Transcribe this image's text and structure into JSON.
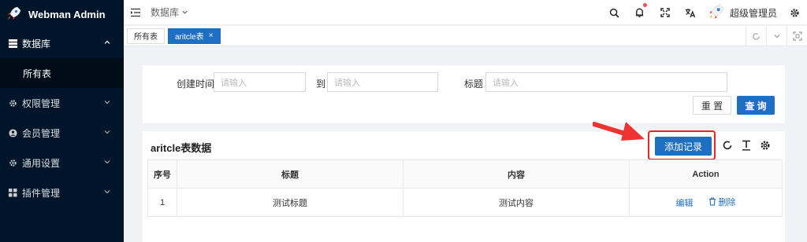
{
  "app": {
    "title": "Webman Admin"
  },
  "sidebar": {
    "items": [
      {
        "label": "数据库",
        "icon": "table-icon",
        "open": true,
        "children": [
          {
            "label": "所有表"
          }
        ]
      },
      {
        "label": "权限管理",
        "icon": "gear-icon"
      },
      {
        "label": "会员管理",
        "icon": "user-circle-icon"
      },
      {
        "label": "通用设置",
        "icon": "gear-icon"
      },
      {
        "label": "插件管理",
        "icon": "apps-icon"
      }
    ]
  },
  "header": {
    "breadcrumb": "数据库",
    "user_name": "超级管理员"
  },
  "tabs": [
    {
      "label": "所有表",
      "active": false
    },
    {
      "label": "aritcle表",
      "active": true,
      "closable": true
    }
  ],
  "filter": {
    "fields": [
      {
        "label": "创建时间",
        "placeholder": "请输入"
      },
      {
        "label": "到",
        "placeholder": "请输入"
      },
      {
        "label": "标题",
        "placeholder": "请输入"
      }
    ],
    "reset_label": "重 置",
    "search_label": "查 询"
  },
  "table_card": {
    "title": "aritcle表数据",
    "add_label": "添加记录",
    "columns": [
      "序号",
      "标题",
      "内容",
      "Action"
    ],
    "rows": [
      {
        "index": "1",
        "title": "测试标题",
        "content": "测试内容"
      }
    ],
    "edit_label": "编辑",
    "delete_label": "删除"
  },
  "colors": {
    "primary": "#1e6fc3",
    "sidebar": "#001529",
    "highlight": "#e22222"
  }
}
